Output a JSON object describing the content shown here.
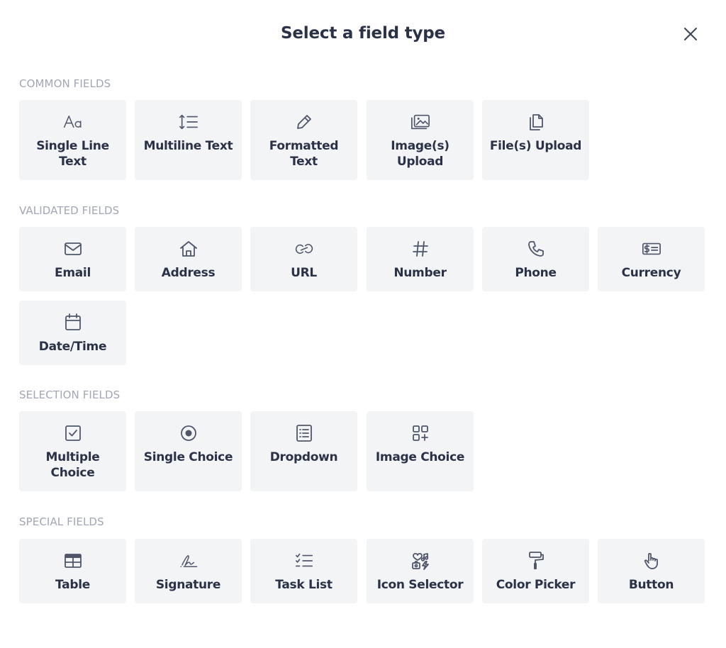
{
  "dialog": {
    "title": "Select a field type",
    "close_icon": "close-icon"
  },
  "sections": {
    "common": {
      "title": "COMMON FIELDS",
      "items": [
        {
          "label": "Single Line Text",
          "icon": "text-aa-icon"
        },
        {
          "label": "Multiline Text",
          "icon": "line-height-list-icon"
        },
        {
          "label": "Formatted Text",
          "icon": "pencil-icon"
        },
        {
          "label": "Image(s) Upload",
          "icon": "images-icon"
        },
        {
          "label": "File(s) Upload",
          "icon": "files-icon"
        }
      ]
    },
    "validated": {
      "title": "VALIDATED FIELDS",
      "items": [
        {
          "label": "Email",
          "icon": "envelope-icon"
        },
        {
          "label": "Address",
          "icon": "house-icon"
        },
        {
          "label": "URL",
          "icon": "link-icon"
        },
        {
          "label": "Number",
          "icon": "hash-icon"
        },
        {
          "label": "Phone",
          "icon": "phone-icon"
        },
        {
          "label": "Currency",
          "icon": "currency-icon"
        },
        {
          "label": "Date/Time",
          "icon": "calendar-icon"
        }
      ]
    },
    "selection": {
      "title": "SELECTION FIELDS",
      "items": [
        {
          "label": "Multiple Choice",
          "icon": "checkbox-icon"
        },
        {
          "label": "Single Choice",
          "icon": "radio-icon"
        },
        {
          "label": "Dropdown",
          "icon": "dropdown-list-icon"
        },
        {
          "label": "Image Choice",
          "icon": "grid-plus-icon"
        }
      ]
    },
    "special": {
      "title": "SPECIAL FIELDS",
      "items": [
        {
          "label": "Table",
          "icon": "table-icon"
        },
        {
          "label": "Signature",
          "icon": "signature-icon"
        },
        {
          "label": "Task List",
          "icon": "task-list-icon"
        },
        {
          "label": "Icon Selector",
          "icon": "icon-selector-icon"
        },
        {
          "label": "Color Picker",
          "icon": "paint-roller-icon"
        },
        {
          "label": "Button",
          "icon": "pointer-hand-icon"
        }
      ]
    }
  },
  "colors": {
    "title": "#2b3147",
    "section_label": "#a2a6b5",
    "card_bg": "#f3f4f6",
    "icon": "#505669"
  }
}
